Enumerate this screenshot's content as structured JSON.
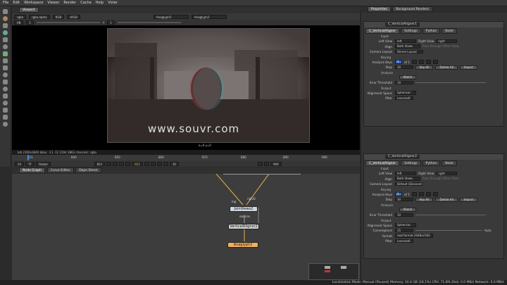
{
  "menu": [
    "File",
    "Edit",
    "Workspace",
    "Viewer",
    "Render",
    "Cache",
    "Help",
    "Vizier"
  ],
  "viewer": {
    "tab": "Viewer1",
    "channels": "rgba",
    "alpha": "rgba.alpha",
    "colorspace": "RGB",
    "lut": "sRGB",
    "input_a": "Anaglyph2",
    "input_b": "Anaglyph2",
    "zoom": "f/8",
    "gain": "1",
    "y_label": "Y",
    "gamma": "1",
    "info": "bdl 2160x3840  bbox: -11 -12 2194 3863 channels: rgba",
    "coord": "x=0 y=0",
    "watermark": "www.souvr.com"
  },
  "timeline": {
    "ticks": [
      "821",
      "840",
      "850",
      "860",
      "870",
      "880",
      "890",
      "900"
    ],
    "start": "821",
    "end": "900",
    "current": "821",
    "fps": "24",
    "tf": "TF",
    "mode": "Global",
    "step": "10"
  },
  "node_tabs": [
    "Node Graph",
    "Curve Editor",
    "Dope Sheet"
  ],
  "nodes": {
    "joinviews": "JoinViews2",
    "source_label": "source",
    "aligner": "VerticalAligner2",
    "anaglyph": "Anaglyph2",
    "input_label": "ing",
    "input_label2": "right2"
  },
  "right_tabs": [
    "Properties",
    "Background Renders"
  ],
  "panels": [
    {
      "name": "C_VerticalAligner1",
      "title": "C_VerticalAligner1",
      "tabs": [
        "C_VerticalAligner",
        "Settings",
        "Python",
        "Node"
      ],
      "input_section": "Input",
      "left_view_label": "Left View",
      "left_view": "left",
      "right_view_label": "Right View",
      "right_view": "right",
      "align_label": "Align",
      "align": "Both Views",
      "passthrough": "Pass through Other View",
      "camera_layout_label": "Camera Layout",
      "camera_layout": "Stereo Layout",
      "keying_section": "Keying",
      "analysis_keys_label": "Analysis Keys",
      "analysis_keys": "1",
      "keys_of": "of 1",
      "step_label": "Step",
      "step": "30",
      "key_all": "Key All",
      "delete_all": "Delete All",
      "import": "Import",
      "analysis_section": "Analysis",
      "match": "Match",
      "error_threshold_label": "Error Threshold",
      "error_threshold": "10",
      "output_section": "Output",
      "alignment_space_label": "Alignment Space",
      "alignment_space": "Spherical",
      "filter_label": "filter",
      "filter": "Lanczos6"
    },
    {
      "name": "C_VerticalAligner2",
      "title": "C_VerticalAligner2",
      "tabs": [
        "C_VerticalAligner",
        "Settings",
        "Python",
        "Node"
      ],
      "input_section": "Input",
      "left_view_label": "Left View",
      "left_view": "left",
      "right_view_label": "Right View",
      "right_view": "right",
      "align_label": "Align",
      "align": "Both Views",
      "passthrough": "Pass through Other View",
      "camera_layout_label": "Camera Layout",
      "camera_layout": "Default (Discover)",
      "keying_section": "Keying",
      "analysis_keys_label": "Analysis Keys",
      "analysis_keys": "1",
      "keys_of": "of 1",
      "step_label": "Step",
      "step": "30",
      "key_all": "Key All",
      "delete_all": "Delete All",
      "import": "Import",
      "analysis_section": "Analysis",
      "match": "Match",
      "error_threshold_label": "Error Threshold",
      "error_threshold": "10",
      "output_section": "Output",
      "alignment_space_label": "Alignment Space",
      "alignment_space": "Spherical",
      "convergence_label": "Convergence",
      "convergence": "15",
      "auto": "Auto",
      "format_label": "format",
      "format": "root.format 2048x2160",
      "filter_label": "filter",
      "filter": "Lanczos6"
    }
  ],
  "status": "Localization Mode: Manual (Paused)  Memory: 10.4 GB (16.1%)  CPU: 71.8%  Disk: 0.0 MB/s  Network: 0.0 MB/s"
}
